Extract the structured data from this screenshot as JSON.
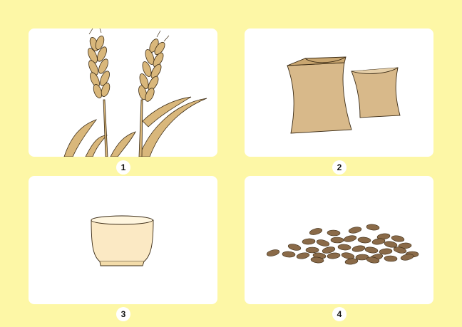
{
  "cards": [
    {
      "number": "1",
      "icon": "wheat-stalks"
    },
    {
      "number": "2",
      "icon": "flour-sacks"
    },
    {
      "number": "3",
      "icon": "bowl"
    },
    {
      "number": "4",
      "icon": "grains"
    }
  ],
  "colors": {
    "background": "#fdf7a6",
    "card": "#ffffff",
    "wheat": "#d9b77b",
    "sack": "#d8b98a",
    "bowl": "#fbe9c4",
    "grain": "#8a6a48"
  }
}
